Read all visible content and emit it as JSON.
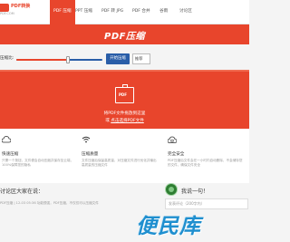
{
  "header": {
    "logo_text": "PDF转换",
    "logo_sub": "PDF.COM",
    "nav": [
      {
        "label": "PDF 压缩",
        "active": true
      },
      {
        "label": "PPT 压缩",
        "active": false
      },
      {
        "label": "PDF 转 JPG",
        "active": false
      },
      {
        "label": "PDF 合并",
        "active": false
      },
      {
        "label": "谷雨",
        "active": false
      },
      {
        "label": "讨论区",
        "active": false
      }
    ]
  },
  "hero": {
    "title": "PDF压缩"
  },
  "slider": {
    "label": "压缩比:",
    "fill_fraction": 0.6,
    "button_label": "开始压缩",
    "select_value": "推荐"
  },
  "upload": {
    "icon_label": "PDF",
    "line1": "将PDF文件拖放到这里",
    "line2_prefix": "或",
    "line2_link": "点击选择PDF文件"
  },
  "features": [
    {
      "icon": "cloud-icon",
      "title": "快速压缩",
      "desc": "只需一个按钮，文件便会自动压缩并保存至云端，100%保障您的隐私"
    },
    {
      "icon": "wifi-icon",
      "title": "压缩质量",
      "desc": "文件压缩后保留高质量，对压缩文件进行优化并输出高质量的压缩文件"
    },
    {
      "icon": "lock-icon",
      "title": "完全安全",
      "desc": "PDF压缩后文件会在一小时内自动删除，不会储存您的文件，确保文件安全"
    }
  ],
  "forum": {
    "title": "讨论区大家在说：",
    "say_label": "我说一句！",
    "comment_preview": "PDF压缩 | 12-03 05:36  功能很强，PDF压缩，不仅仅可以压缩文件",
    "input_placeholder": "发表评论（200字内）"
  },
  "watermark": {
    "text": "便民库"
  },
  "colors": {
    "brand": "#e8452c",
    "accent": "#2a5ea8",
    "watermark": "#1f8fcf"
  }
}
